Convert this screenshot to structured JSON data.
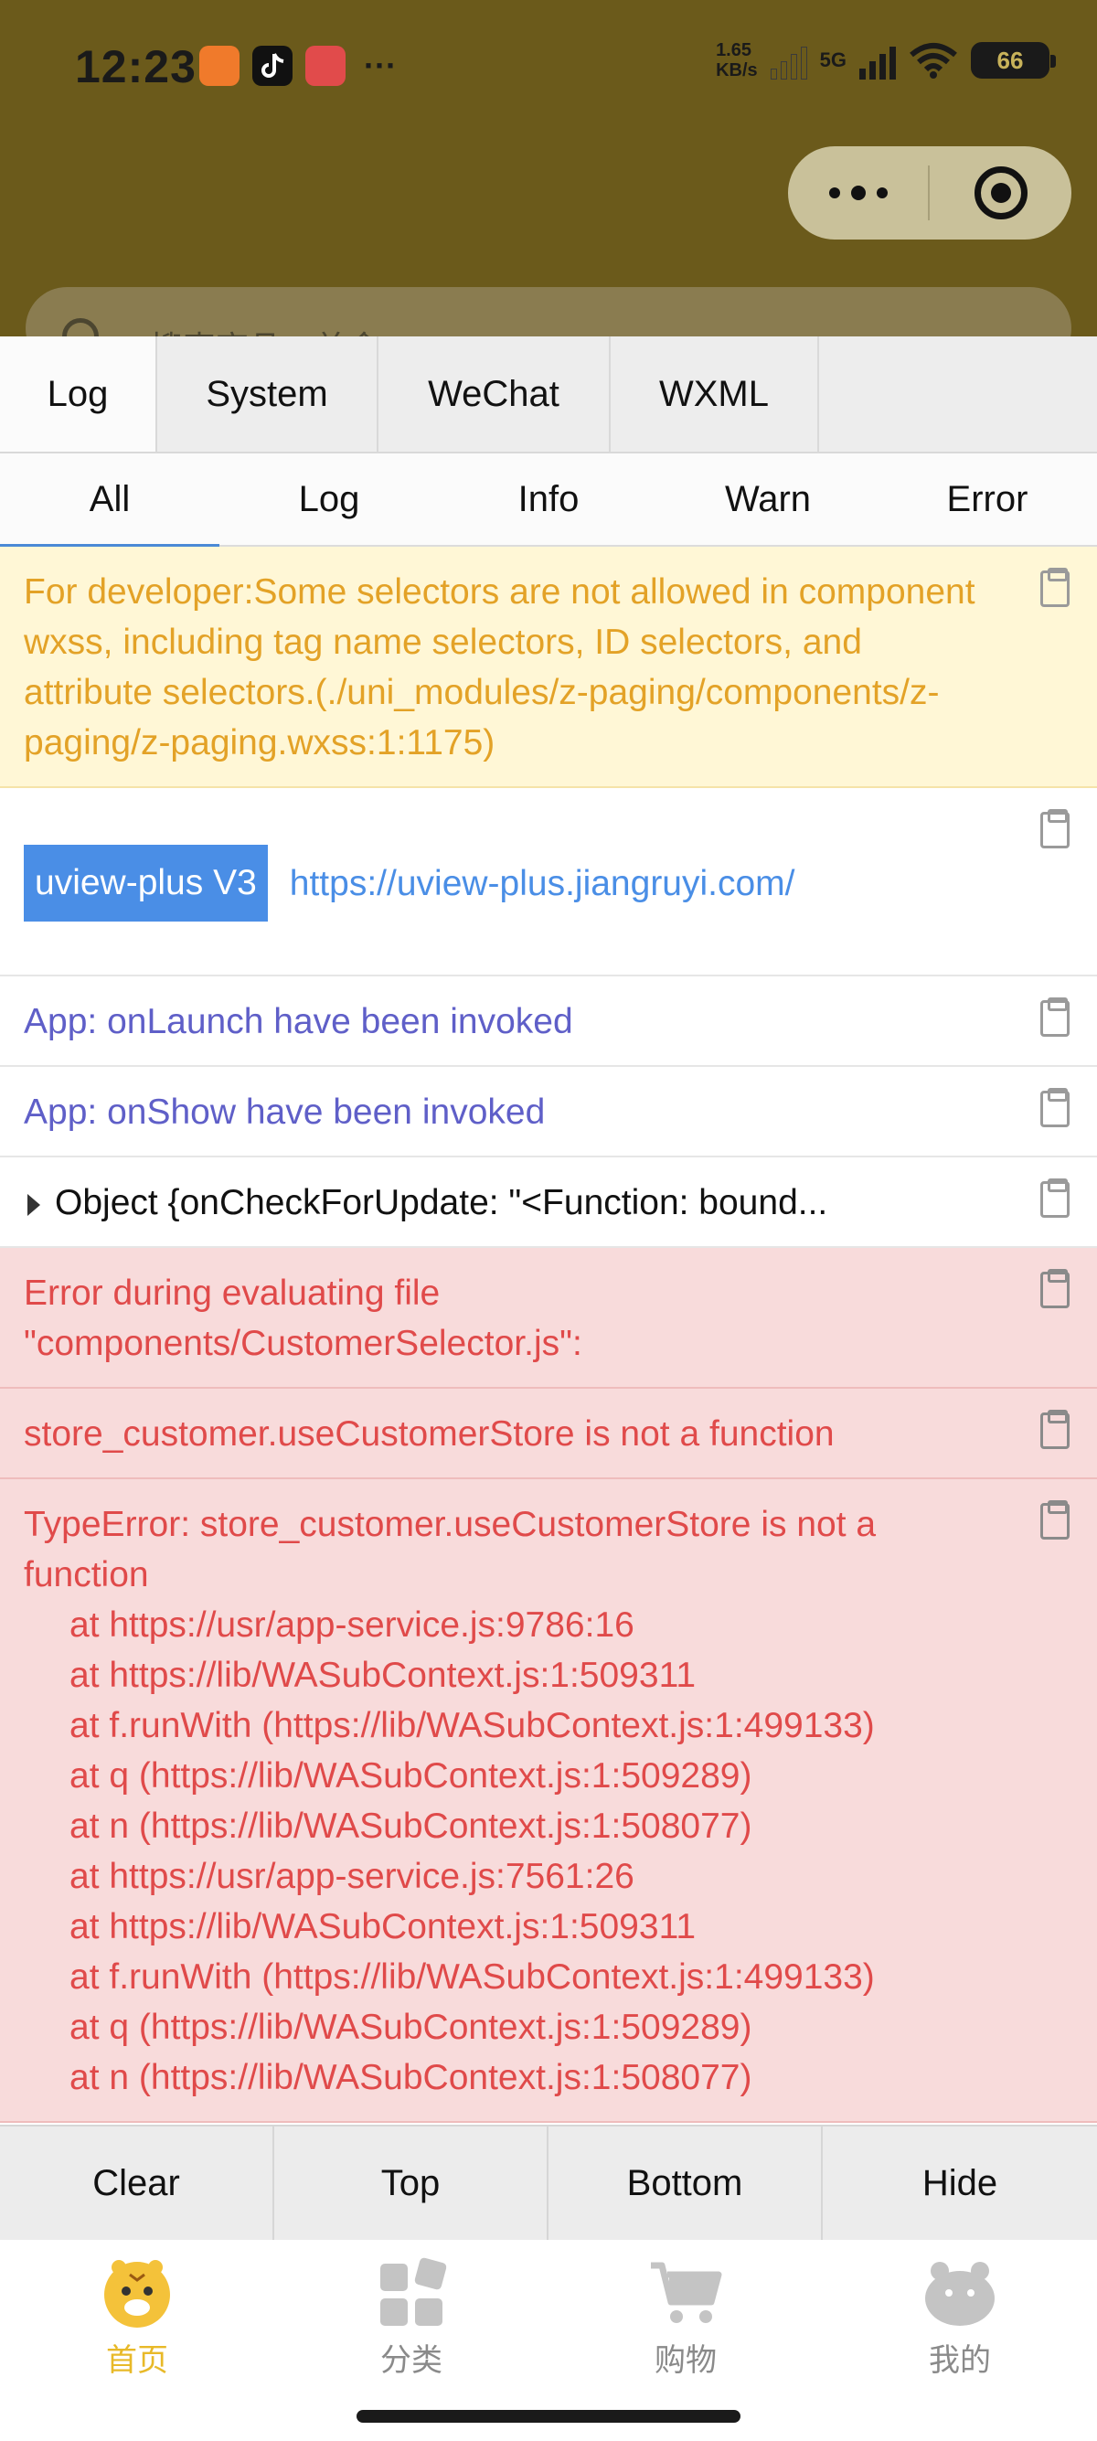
{
  "status_bar": {
    "time": "12:23",
    "more": "···",
    "net_speed_value": "1.65",
    "net_speed_unit": "KB/s",
    "network": "5G",
    "battery": "66",
    "app_icons": [
      "taobao-icon",
      "tiktok-icon",
      "game-icon"
    ]
  },
  "header": {
    "search_placeholder": "搜索商品、美食"
  },
  "vconsole": {
    "tabs": [
      {
        "label": "Log",
        "active": true
      },
      {
        "label": "System",
        "active": false
      },
      {
        "label": "WeChat",
        "active": false
      },
      {
        "label": "WXML",
        "active": false
      }
    ],
    "subtabs": [
      {
        "label": "All",
        "active": true
      },
      {
        "label": "Log",
        "active": false
      },
      {
        "label": "Info",
        "active": false
      },
      {
        "label": "Warn",
        "active": false
      },
      {
        "label": "Error",
        "active": false
      }
    ],
    "logs": {
      "warn_1": "For developer:Some selectors are not allowed in component wxss, including tag name selectors, ID selectors, and attribute selectors.(./uni_modules/z-paging/components/z-paging/z-paging.wxss:1:1175)",
      "banner_badge": "uview-plus V3",
      "banner_link": "https://uview-plus.jiangruyi.com/",
      "info_1": "App: onLaunch have been invoked",
      "info_2": "App: onShow have been invoked",
      "object_1": "Object {onCheckForUpdate: \"<Function: bound...",
      "error_1": "Error during evaluating file \"components/CustomerSelector.js\":",
      "error_2": "store_customer.useCustomerStore is not a function",
      "error_3_head": "TypeError: store_customer.useCustomerStore is not a function",
      "error_3_stack": [
        "at https://usr/app-service.js:9786:16",
        "at https://lib/WASubContext.js:1:509311",
        "at f.runWith (https://lib/WASubContext.js:1:499133)",
        "at q (https://lib/WASubContext.js:1:509289)",
        "at n (https://lib/WASubContext.js:1:508077)",
        "at https://usr/app-service.js:7561:26",
        "at https://lib/WASubContext.js:1:509311",
        "at f.runWith (https://lib/WASubContext.js:1:499133)",
        "at q (https://lib/WASubContext.js:1:509289)",
        "at n (https://lib/WASubContext.js:1:508077)"
      ]
    },
    "toolbar": {
      "clear": "Clear",
      "top": "Top",
      "bottom": "Bottom",
      "hide": "Hide"
    }
  },
  "tabbar": {
    "items": [
      {
        "label": "首页",
        "icon": "tiger-mascot-icon",
        "active": true
      },
      {
        "label": "分类",
        "icon": "category-grid-icon",
        "active": false
      },
      {
        "label": "购物",
        "icon": "shopping-cart-icon",
        "active": false
      },
      {
        "label": "我的",
        "icon": "profile-bear-icon",
        "active": false
      }
    ]
  },
  "colors": {
    "header_bg": "#6b5a1b",
    "accent": "#e8b928",
    "warn_text": "#e3a227",
    "error_text": "#e04a4a",
    "info_text": "#5f5fc8",
    "link": "#4a8ee6"
  }
}
